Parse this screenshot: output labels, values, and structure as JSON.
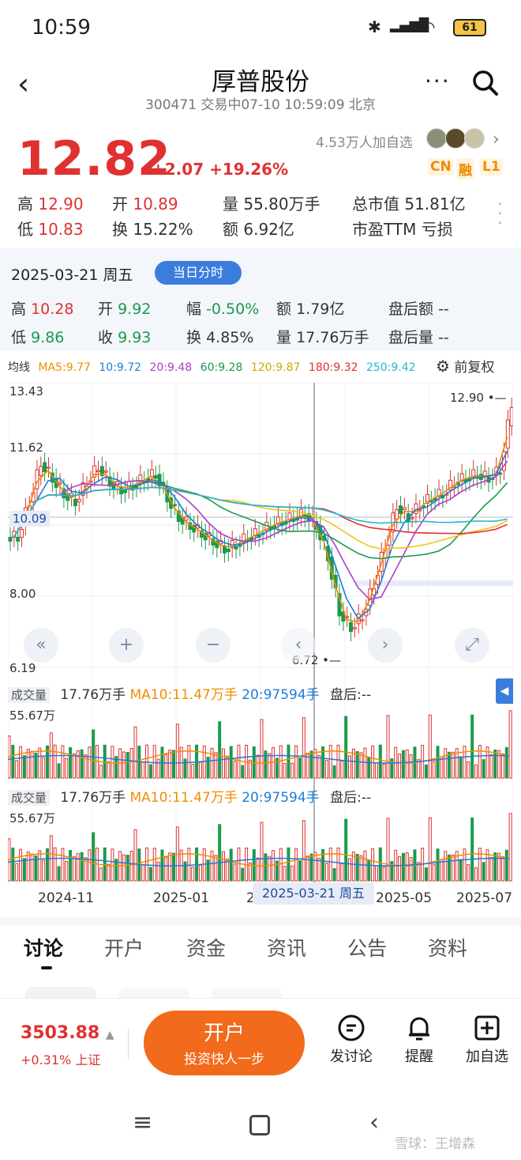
{
  "status": {
    "time": "10:59",
    "battery": "61"
  },
  "header": {
    "title": "厚普股份",
    "subtitle": "300471 交易中07-10 10:59:09 北京"
  },
  "price": {
    "last": "12.82",
    "change": "+2.07 +19.26%",
    "followers": "4.53万人加自选",
    "tags": [
      "CN",
      "融",
      "L1"
    ]
  },
  "quote": {
    "high_label": "高",
    "high": "12.90",
    "open_label": "开",
    "open": "10.89",
    "vol_label": "量",
    "vol": "55.80万手",
    "cap_label": "总市值",
    "cap": "51.81亿",
    "low_label": "低",
    "low": "10.83",
    "turn_label": "换",
    "turn": "15.22%",
    "amt_label": "额",
    "amt": "6.92亿",
    "pe_label": "市盈TTM",
    "pe": "亏损"
  },
  "panel": {
    "date": "2025-03-21 周五",
    "intraday_btn": "当日分时",
    "high_label": "高",
    "high": "10.28",
    "open_label": "开",
    "open": "9.92",
    "range_label": "幅",
    "range": "-0.50%",
    "amt_label": "额",
    "amt": "1.79亿",
    "after_amt_label": "盘后额",
    "after_amt": "--",
    "low_label": "低",
    "low": "9.86",
    "close_label": "收",
    "close": "9.93",
    "turn_label": "换",
    "turn": "4.85%",
    "vol_label": "量",
    "vol": "17.76万手",
    "after_vol_label": "盘后量",
    "after_vol": "--"
  },
  "ma": {
    "label": "均线",
    "ma5": "MA5:9.77",
    "ma10": "10:9.72",
    "ma20": "20:9.48",
    "ma60": "60:9.28",
    "ma120": "120:9.87",
    "ma180": "180:9.32",
    "ma250": "250:9.42",
    "adjust": "前复权",
    "colors": {
      "ma5": "#f08c00",
      "ma10": "#1c7ed6",
      "ma20": "#ae3ec9",
      "ma60": "#1a9b4b",
      "ma120": "#f0c419",
      "ma180": "#e03131",
      "ma250": "#22b8cf"
    }
  },
  "chart": {
    "y_top": "13.43",
    "y_mid1": "11.62",
    "y_cross": "10.09",
    "y_mid2": "8.00",
    "y_bottom": "6.19",
    "max_label": "12.90",
    "min_label": "6.72"
  },
  "volume": [
    {
      "tag": "成交量",
      "vol": "17.76万手",
      "ma10": "MA10:11.47万手",
      "ma20": "20:97594手",
      "after": "盘后:--",
      "max": "55.67万"
    },
    {
      "tag": "成交量",
      "vol": "17.76万手",
      "ma10": "MA10:11.47万手",
      "ma20": "20:97594手",
      "after": "盘后:--",
      "max": "55.67万"
    }
  ],
  "xaxis": {
    "t1": "2024-11",
    "t2": "2025-01",
    "t3": "2",
    "crosshair": "2025-03-21 周五",
    "t4": "2025-05",
    "t5": "2025-07"
  },
  "tabs": [
    "讨论",
    "开户",
    "资金",
    "资讯",
    "公告",
    "资料"
  ],
  "bottom": {
    "index_val": "3503.88",
    "index_chg": "+0.31% 上证",
    "open_big": "开户",
    "open_small": "投资快人一步",
    "discuss": "发讨论",
    "remind": "提醒",
    "add": "加自选"
  },
  "watermark": "雪球：王增森"
}
